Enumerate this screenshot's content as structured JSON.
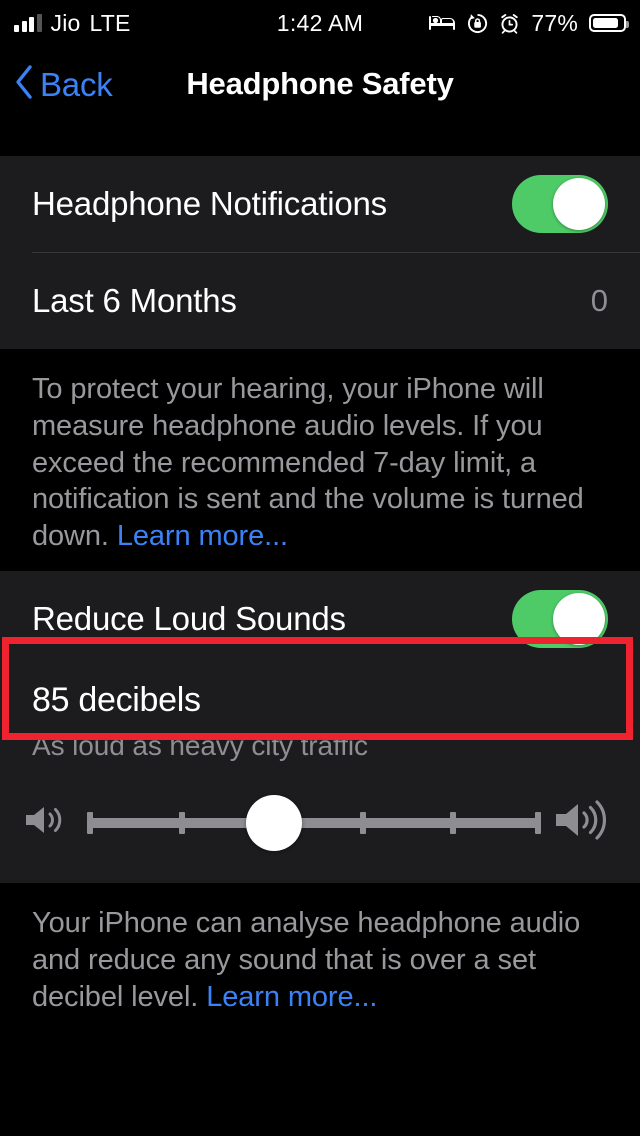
{
  "statusbar": {
    "carrier": "Jio",
    "network": "LTE",
    "time": "1:42 AM",
    "battery_percent": "77%",
    "icons": [
      "signal-bars-icon",
      "bed-icon",
      "rotation-lock-icon",
      "alarm-clock-icon",
      "battery-icon"
    ]
  },
  "navbar": {
    "back_label": "Back",
    "title": "Headphone Safety"
  },
  "section1": {
    "rows": [
      {
        "title": "Headphone Notifications",
        "toggle": "on"
      },
      {
        "title": "Last 6 Months",
        "value": "0"
      }
    ],
    "footer_text": "To protect your hearing, your iPhone will measure headphone audio levels. If you exceed the recommended 7-day limit, a notification is sent and the volume is turned down. ",
    "footer_link": "Learn more..."
  },
  "section2": {
    "row_title": "Reduce Loud Sounds",
    "toggle": "on",
    "decibel_value": "85 decibels",
    "decibel_caption": "As loud as heavy city traffic",
    "slider": {
      "left_icon": "speaker-quiet-icon",
      "right_icon": "speaker-loud-icon",
      "position_percent": 41,
      "tick_percents": [
        0,
        20.5,
        61,
        81,
        100
      ]
    },
    "footer_text": "Your iPhone can analyse headphone audio and reduce any sound that is over a set decibel level. ",
    "footer_link": "Learn more..."
  },
  "annotation": {
    "color": "#ef2230",
    "label": "reduce-loud-sounds-highlight"
  }
}
